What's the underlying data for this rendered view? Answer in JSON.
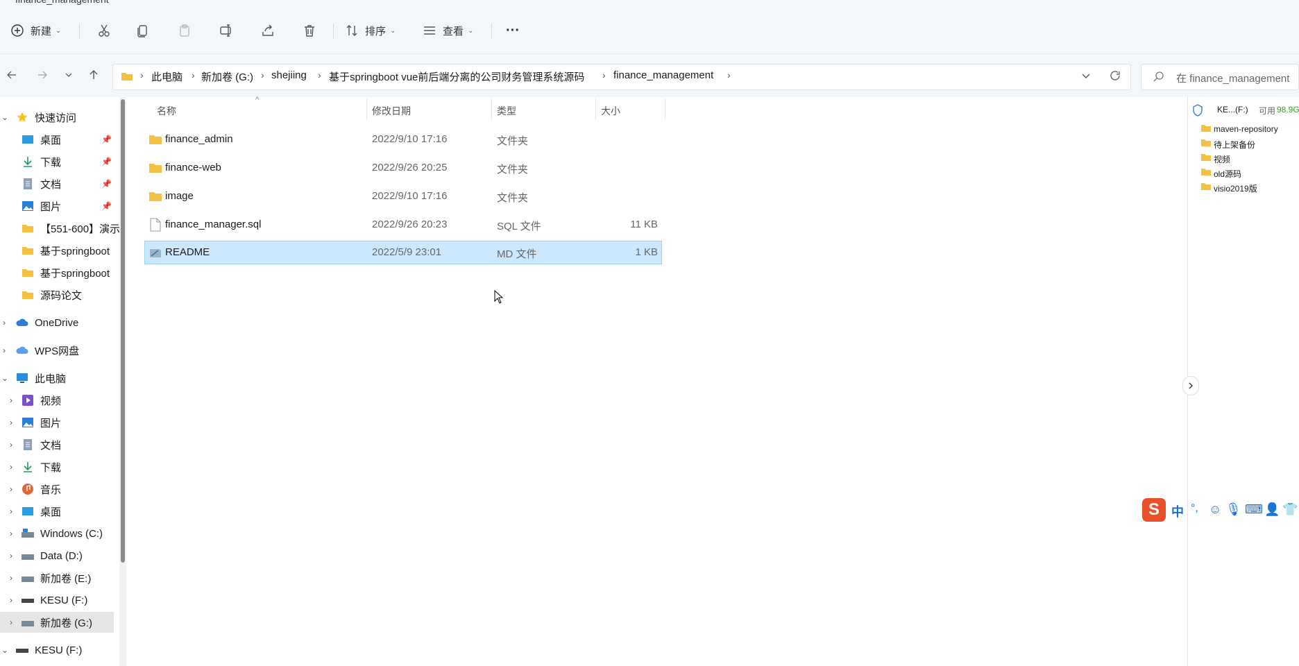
{
  "window": {
    "title": "finance_management"
  },
  "toolbar": {
    "new_label": "新建",
    "sort_label": "排序",
    "view_label": "查看",
    "more": "···"
  },
  "breadcrumb": [
    "此电脑",
    "新加卷 (G:)",
    "shejiing",
    "基于springboot vue前后端分离的公司财务管理系统源码",
    "finance_management"
  ],
  "search": {
    "placeholder": "在 finance_management"
  },
  "sidebar": {
    "quick_access": "快速访问",
    "quick_items": [
      "桌面",
      "下载",
      "文档",
      "图片",
      "【551-600】演示",
      "基于springboot",
      "基于springboot",
      "源码论文"
    ],
    "onedrive": "OneDrive",
    "wps": "WPS网盘",
    "this_pc": "此电脑",
    "pc_items": [
      "视频",
      "图片",
      "文档",
      "下载",
      "音乐",
      "桌面",
      "Windows (C:)",
      "Data (D:)",
      "新加卷 (E:)",
      "KESU  (F:)",
      "新加卷 (G:)"
    ],
    "kesu_root": "KESU  (F:)"
  },
  "columns": {
    "name": "名称",
    "date": "修改日期",
    "type": "类型",
    "size": "大小"
  },
  "files": [
    {
      "name": "finance_admin",
      "date": "2022/9/10 17:16",
      "type": "文件夹",
      "size": "",
      "kind": "folder"
    },
    {
      "name": "finance-web",
      "date": "2022/9/26 20:25",
      "type": "文件夹",
      "size": "",
      "kind": "folder"
    },
    {
      "name": "image",
      "date": "2022/9/10 17:16",
      "type": "文件夹",
      "size": "",
      "kind": "folder"
    },
    {
      "name": "finance_manager.sql",
      "date": "2022/9/26 20:23",
      "type": "SQL 文件",
      "size": "11 KB",
      "kind": "file"
    },
    {
      "name": "README",
      "date": "2022/5/9 23:01",
      "type": "MD 文件",
      "size": "1 KB",
      "kind": "md",
      "selected": true
    }
  ],
  "right_panel": {
    "drive_label": "KE...(F:)",
    "free_label": "可用",
    "free_value": "98.9G",
    "folders": [
      "maven-repository",
      "待上架备份",
      "视频",
      "old源码",
      "visio2019版"
    ]
  },
  "ime": {
    "mode": "中",
    "punct": "°,"
  },
  "colors": {
    "accent": "#0067c0",
    "selection": "#cce8ff",
    "folder": "#f3c244",
    "green": "#3a9a2a"
  }
}
